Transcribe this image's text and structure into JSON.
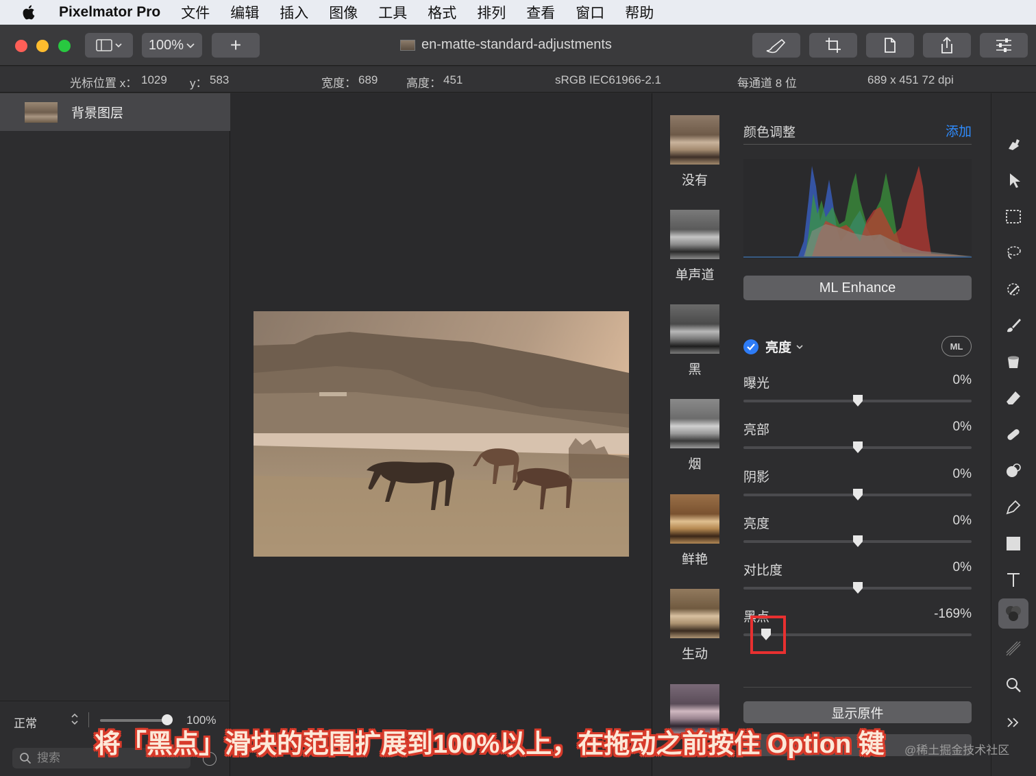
{
  "menubar": {
    "app_name": "Pixelmator Pro",
    "items": [
      "文件",
      "编辑",
      "插入",
      "图像",
      "工具",
      "格式",
      "排列",
      "查看",
      "窗口",
      "帮助"
    ]
  },
  "toolbar": {
    "zoom": "100%",
    "add": "+",
    "document_title": "en-matte-standard-adjustments"
  },
  "infobar": {
    "cursor_x_label": "光标位置 x：",
    "cursor_x": "1029",
    "cursor_y_label": "y：",
    "cursor_y": "583",
    "width_label": "宽度：",
    "width": "689",
    "height_label": "高度：",
    "height": "451",
    "color_profile": "sRGB IEC61966-2.1",
    "bit_depth": "每通道 8 位",
    "dimensions": "689 x 451 72 dpi"
  },
  "layers": {
    "items": [
      {
        "name": "背景图层"
      }
    ],
    "blend_mode": "正常",
    "opacity": "100%",
    "search_placeholder": "搜索"
  },
  "presets": [
    {
      "label": "没有"
    },
    {
      "label": "单声道"
    },
    {
      "label": "黑"
    },
    {
      "label": "烟"
    },
    {
      "label": "鲜艳"
    },
    {
      "label": "生动"
    }
  ],
  "adjustments": {
    "section_title": "颜色调整",
    "add_label": "添加",
    "ml_enhance": "ML Enhance",
    "group_title": "亮度",
    "ml_badge": "ML",
    "sliders": [
      {
        "label": "曝光",
        "value": "0%",
        "position": 0.5
      },
      {
        "label": "亮部",
        "value": "0%",
        "position": 0.5
      },
      {
        "label": "阴影",
        "value": "0%",
        "position": 0.5
      },
      {
        "label": "亮度",
        "value": "0%",
        "position": 0.5
      },
      {
        "label": "对比度",
        "value": "0%",
        "position": 0.5
      },
      {
        "label": "黑点",
        "value": "-169%",
        "position": 0.1
      }
    ],
    "show_original": "显示原件"
  },
  "caption": "将「黑点」滑块的范围扩展到100%以上，在拖动之前按住 Option 键",
  "watermark": "@稀土掘金技术社区",
  "colors": {
    "accent": "#2e8cff",
    "highlight": "#e83030",
    "caption_outline": "#d73a2a"
  },
  "tool_icons": [
    "stamp-icon",
    "arrow-icon",
    "rect-select-icon",
    "lasso-icon",
    "magic-wand-icon",
    "brush-icon",
    "fill-icon",
    "eraser-icon",
    "bandage-icon",
    "clone-icon",
    "pen-icon",
    "shape-icon",
    "text-icon",
    "color-adjust-icon",
    "effects-icon",
    "zoom-icon",
    "more-icon"
  ]
}
